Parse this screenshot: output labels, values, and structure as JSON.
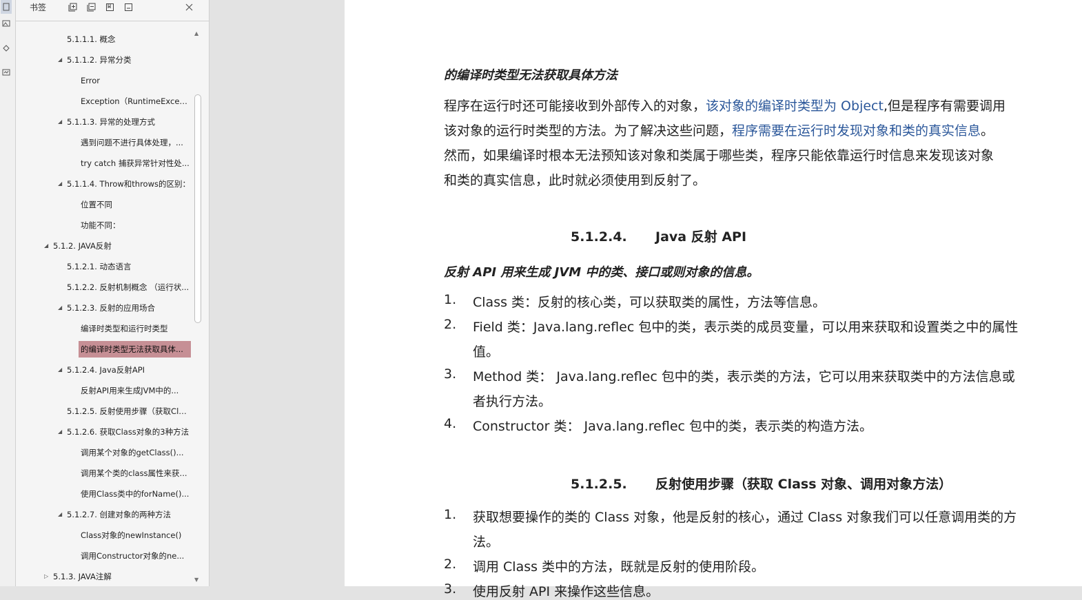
{
  "sidebar": {
    "title": "书签",
    "icons": [
      "expand-all-icon",
      "collapse-all-icon",
      "add-bookmark-icon",
      "bookmark-options-icon",
      "close-icon"
    ],
    "items": [
      {
        "label": "5.1.1.1. 概念",
        "level": 2,
        "toggle": ""
      },
      {
        "label": "5.1.1.2. 异常分类",
        "level": 2,
        "toggle": "expanded"
      },
      {
        "label": "Error",
        "level": 3,
        "toggle": ""
      },
      {
        "label": "Exception（RuntimeExcep...",
        "level": 3,
        "toggle": ""
      },
      {
        "label": "5.1.1.3. 异常的处理方式",
        "level": 2,
        "toggle": "expanded"
      },
      {
        "label": "遇到问题不进行具体处理，...",
        "level": 3,
        "toggle": ""
      },
      {
        "label": "try catch 捕获异常针对性处...",
        "level": 3,
        "toggle": ""
      },
      {
        "label": "5.1.1.4. Throw和throws的区别：",
        "level": 2,
        "toggle": "expanded"
      },
      {
        "label": "位置不同",
        "level": 3,
        "toggle": ""
      },
      {
        "label": "功能不同：",
        "level": 3,
        "toggle": ""
      },
      {
        "label": "5.1.2. JAVA反射",
        "level": 1,
        "toggle": "expanded"
      },
      {
        "label": "5.1.2.1. 动态语言",
        "level": 2,
        "toggle": ""
      },
      {
        "label": "5.1.2.2. 反射机制概念 （运行状...",
        "level": 2,
        "toggle": ""
      },
      {
        "label": "5.1.2.3. 反射的应用场合",
        "level": 2,
        "toggle": "expanded"
      },
      {
        "label": "编译时类型和运行时类型",
        "level": 3,
        "toggle": ""
      },
      {
        "label": "的编译时类型无法获取具体...",
        "level": 3,
        "toggle": "",
        "selected": true
      },
      {
        "label": "5.1.2.4. Java反射API",
        "level": 2,
        "toggle": "expanded"
      },
      {
        "label": "反射API用来生成JVM中的...",
        "level": 3,
        "toggle": ""
      },
      {
        "label": "5.1.2.5. 反射使用步骤（获取Cla...",
        "level": 2,
        "toggle": ""
      },
      {
        "label": "5.1.2.6. 获取Class对象的3种方法",
        "level": 2,
        "toggle": "expanded"
      },
      {
        "label": "调用某个对象的getClass()...",
        "level": 3,
        "toggle": ""
      },
      {
        "label": "调用某个类的class属性来获...",
        "level": 3,
        "toggle": ""
      },
      {
        "label": "使用Class类中的forName()...",
        "level": 3,
        "toggle": ""
      },
      {
        "label": "5.1.2.7. 创建对象的两种方法",
        "level": 2,
        "toggle": "expanded"
      },
      {
        "label": "Class对象的newInstance()",
        "level": 3,
        "toggle": ""
      },
      {
        "label": "调用Constructor对象的ne...",
        "level": 3,
        "toggle": ""
      },
      {
        "label": "5.1.3. JAVA注解",
        "level": 1,
        "toggle": "collapsed"
      }
    ]
  },
  "document": {
    "subheading1": "的编译时类型无法获取具体方法",
    "para1": [
      [
        {
          "t": "程序在运行时还可能接收到外部传入的对象，",
          "c": ""
        },
        {
          "t": "该对象的编译时类型为 Object",
          "c": "blue"
        },
        {
          "t": ",但是程序有需要调用",
          "c": ""
        }
      ],
      [
        {
          "t": "该对象的运行时类型的方法。为了解决这些问题，",
          "c": ""
        },
        {
          "t": "程序需要在运行时发现对象和类的真实信息",
          "c": "blue"
        },
        {
          "t": "。",
          "c": ""
        }
      ],
      [
        {
          "t": "然而，如果编译时根本无法预知该对象和类属于哪些类，程序只能依靠运行时信息来发现该对象",
          "c": ""
        }
      ],
      [
        {
          "t": "和类的真实信息，此时就必须使用到反射了。",
          "c": ""
        }
      ]
    ],
    "heading1_num": "5.1.2.4.",
    "heading1_text": "Java 反射 API",
    "subheading2": "反射 API 用来生成 JVM 中的类、接口或则对象的信息。",
    "list1": [
      {
        "num": "1.",
        "lines": [
          "Class 类：反射的核心类，可以获取类的属性，方法等信息。"
        ]
      },
      {
        "num": "2.",
        "lines": [
          "Field 类：Java.lang.reflec 包中的类，表示类的成员变量，可以用来获取和设置类之中的属性",
          "值。"
        ]
      },
      {
        "num": "3.",
        "lines": [
          "Method 类： Java.lang.reflec 包中的类，表示类的方法，它可以用来获取类中的方法信息或",
          "者执行方法。"
        ]
      },
      {
        "num": "4.",
        "lines": [
          "Constructor 类： Java.lang.reflec 包中的类，表示类的构造方法。"
        ]
      }
    ],
    "heading2_num": "5.1.2.5.",
    "heading2_text": "反射使用步骤（获取 Class 对象、调用对象方法）",
    "list2": [
      {
        "num": "1.",
        "lines": [
          "获取想要操作的类的 Class 对象，他是反射的核心，通过 Class 对象我们可以任意调用类的方",
          "法。"
        ]
      },
      {
        "num": "2.",
        "lines": [
          "调用 Class 类中的方法，既就是反射的使用阶段。"
        ]
      },
      {
        "num": "3.",
        "lines": [
          "使用反射 API 来操作这些信息。"
        ]
      }
    ]
  }
}
